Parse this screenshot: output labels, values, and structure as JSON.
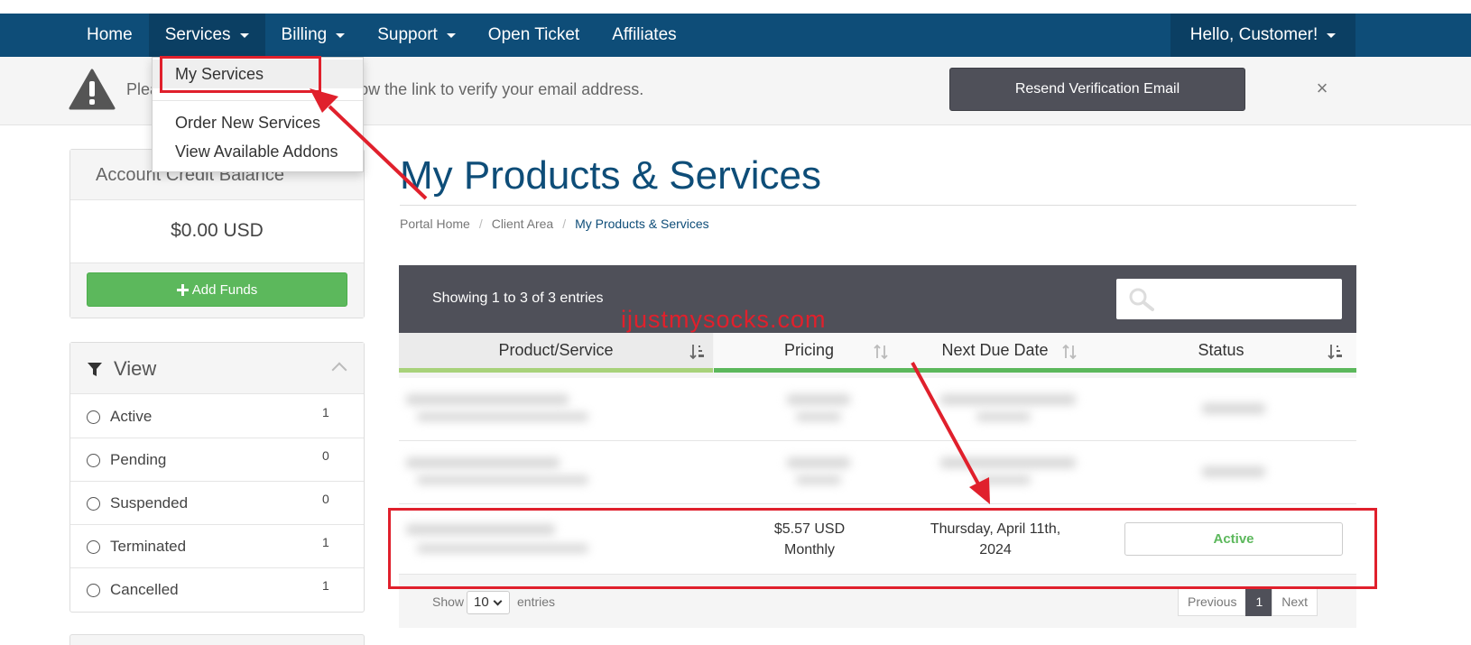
{
  "nav": {
    "items": [
      {
        "label": "Home",
        "has_caret": false
      },
      {
        "label": "Services",
        "has_caret": true
      },
      {
        "label": "Billing",
        "has_caret": true
      },
      {
        "label": "Support",
        "has_caret": true
      },
      {
        "label": "Open Ticket",
        "has_caret": false
      },
      {
        "label": "Affiliates",
        "has_caret": false
      }
    ],
    "user_menu": "Hello, Customer!"
  },
  "services_menu": {
    "items": [
      "My Services",
      "Order New Services",
      "View Available Addons"
    ]
  },
  "alert": {
    "text": "Please check your email and follow the link to verify your email address.",
    "resend_label": "Resend Verification Email",
    "close_glyph": "×"
  },
  "credit": {
    "title": "Account Credit Balance",
    "amount": "$0.00 USD",
    "add_funds_label": "Add Funds"
  },
  "view_filter": {
    "title": "View",
    "items": [
      {
        "label": "Active",
        "count": "1"
      },
      {
        "label": "Pending",
        "count": "0"
      },
      {
        "label": "Suspended",
        "count": "0"
      },
      {
        "label": "Terminated",
        "count": "1"
      },
      {
        "label": "Cancelled",
        "count": "1"
      }
    ]
  },
  "page": {
    "title": "My Products & Services",
    "breadcrumb": [
      "Portal Home",
      "Client Area",
      "My Products & Services"
    ]
  },
  "table": {
    "entries_info": "Showing 1 to 3 of 3 entries",
    "watermark": "ijustmysocks.com",
    "columns": [
      "Product/Service",
      "Pricing",
      "Next Due Date",
      "Status"
    ],
    "visible_row": {
      "price": "$5.57 USD",
      "cycle": "Monthly",
      "due_line1": "Thursday, April 11th,",
      "due_line2": "2024",
      "status": "Active"
    },
    "footer": {
      "show_label": "Show",
      "page_size": "10",
      "entries_label": "entries",
      "previous": "Previous",
      "current_page": "1",
      "next": "Next"
    }
  },
  "colors": {
    "navbar": "#0e4d78",
    "accent_green": "#5cb85c",
    "dark_button": "#4f5059",
    "annotation_red": "#e0202c"
  }
}
